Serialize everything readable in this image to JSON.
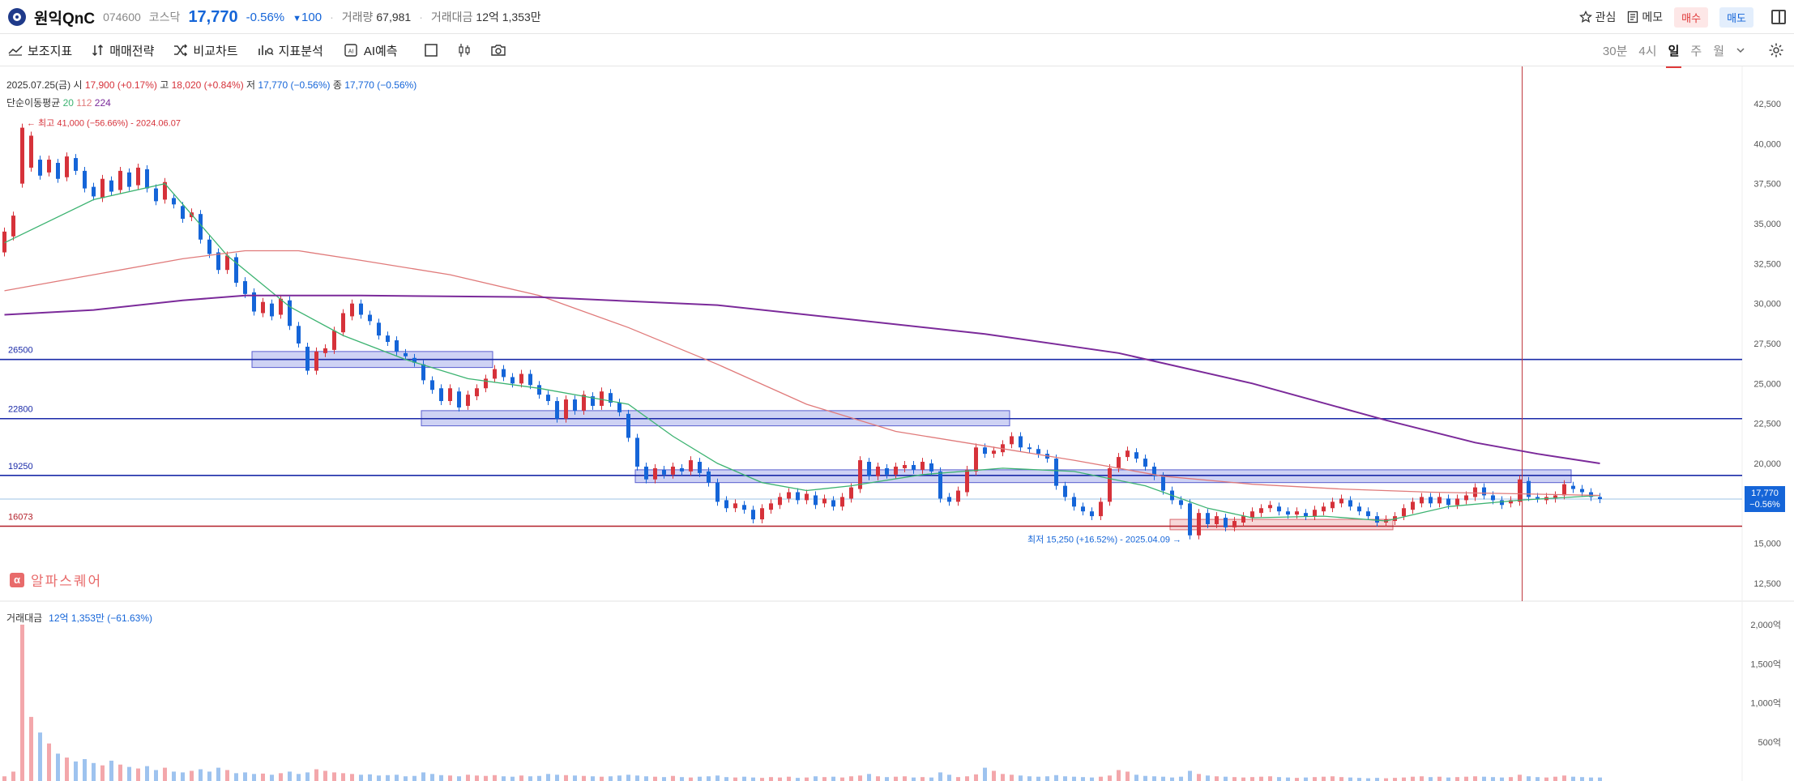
{
  "header": {
    "name": "원익QnC",
    "code": "074600",
    "market": "코스닥",
    "price": "17,770",
    "change_pct": "-0.56%",
    "change": "100",
    "volume_label": "거래량",
    "volume_value": "67,981",
    "amount_label": "거래대금",
    "amount_value": "12억 1,353만",
    "favorite_label": "관심",
    "memo_label": "메모",
    "buy_label": "매수",
    "sell_label": "매도"
  },
  "toolbar": {
    "indicators_label": "보조지표",
    "strategy_label": "매매전략",
    "compare_label": "비교차트",
    "analysis_label": "지표분석",
    "ai_label": "AI예측",
    "periods": [
      "30분",
      "4시",
      "일",
      "주",
      "월"
    ],
    "active_period": "일"
  },
  "info": {
    "date": "2025.07.25(금)",
    "open_label": "시",
    "open": "17,900 (+0.17%)",
    "high_label": "고",
    "high": "18,020 (+0.84%)",
    "low_label": "저",
    "low": "17,770 (−0.56%)",
    "close_label": "종",
    "close": "17,770 (−0.56%)",
    "ma_label": "단순이동평균",
    "ma1": "20",
    "ma2": "112",
    "ma3": "224"
  },
  "alpha": {
    "icon_letter": "α",
    "label": "알파스퀘어"
  },
  "volume_info": {
    "label": "거래대금",
    "value": "12억 1,353만 (−61.63%)"
  },
  "price_badge": {
    "price": "17,770",
    "pct": "−0.56%"
  },
  "colors": {
    "up": "#d6323a",
    "down": "#1565d8",
    "ma20": "#3cb371",
    "ma112": "#e07a7a",
    "ma224": "#7b2a9a",
    "level_blue": "#1a2aa8",
    "level_red": "#b3202a",
    "box_fill": "#b9bff0",
    "box_stroke": "#5a5fd0"
  },
  "chart_data": {
    "type": "candlestick",
    "y_ticks": [
      "42,500",
      "40,000",
      "37,500",
      "35,000",
      "32,500",
      "30,000",
      "27,500",
      "25,000",
      "22,500",
      "20,000",
      "17,500",
      "15,000",
      "12,500"
    ],
    "ylim": [
      12000,
      43500
    ],
    "x_range": [
      0,
      200
    ],
    "current_price": 17770,
    "max_label": "최고 41,000 (−56.66%) - 2024.06.07",
    "max": {
      "x": 2,
      "price": 41000
    },
    "min_label": "최저 15,250 (+16.52%) - 2025.04.09",
    "min": {
      "x": 133,
      "price": 15250
    },
    "levels": [
      {
        "label": "26500",
        "price": 26500,
        "color": "#1a2aa8"
      },
      {
        "label": "22800",
        "price": 22800,
        "color": "#1a2aa8"
      },
      {
        "label": "19250",
        "price": 19250,
        "color": "#1a2aa8"
      },
      {
        "label": "16073",
        "price": 16073,
        "color": "#b3202a"
      }
    ],
    "boxes": [
      {
        "x0": 28,
        "x1": 55,
        "top": 27000,
        "bottom": 26000,
        "color": "blue"
      },
      {
        "x0": 47,
        "x1": 113,
        "top": 23300,
        "bottom": 22350,
        "color": "blue"
      },
      {
        "x0": 71,
        "x1": 176,
        "top": 19600,
        "bottom": 18800,
        "color": "blue"
      },
      {
        "x0": 131,
        "x1": 156,
        "top": 16500,
        "bottom": 15850,
        "color": "red"
      }
    ],
    "crosshair_x": 170.5,
    "ma_series": [
      {
        "name": "20",
        "points": [
          [
            0,
            33800
          ],
          [
            10,
            36500
          ],
          [
            18,
            37500
          ],
          [
            25,
            33000
          ],
          [
            32,
            29800
          ],
          [
            38,
            28000
          ],
          [
            45,
            26500
          ],
          [
            52,
            25300
          ],
          [
            60,
            24700
          ],
          [
            70,
            23700
          ],
          [
            75,
            21700
          ],
          [
            80,
            20000
          ],
          [
            85,
            18800
          ],
          [
            90,
            18300
          ],
          [
            95,
            18600
          ],
          [
            103,
            19300
          ],
          [
            112,
            19700
          ],
          [
            120,
            19500
          ],
          [
            128,
            18600
          ],
          [
            135,
            17200
          ],
          [
            140,
            16600
          ],
          [
            148,
            16700
          ],
          [
            155,
            16400
          ],
          [
            162,
            17300
          ],
          [
            170,
            17700
          ],
          [
            179,
            18000
          ]
        ]
      },
      {
        "name": "112",
        "points": [
          [
            0,
            30800
          ],
          [
            10,
            31800
          ],
          [
            20,
            32800
          ],
          [
            27,
            33300
          ],
          [
            33,
            33300
          ],
          [
            40,
            32700
          ],
          [
            50,
            31800
          ],
          [
            60,
            30500
          ],
          [
            70,
            28500
          ],
          [
            80,
            26200
          ],
          [
            90,
            23700
          ],
          [
            100,
            22000
          ],
          [
            110,
            21100
          ],
          [
            120,
            20200
          ],
          [
            130,
            19200
          ],
          [
            140,
            18700
          ],
          [
            150,
            18400
          ],
          [
            160,
            18200
          ],
          [
            170,
            18100
          ],
          [
            179,
            18000
          ]
        ]
      },
      {
        "name": "224",
        "points": [
          [
            0,
            29300
          ],
          [
            10,
            29600
          ],
          [
            20,
            30200
          ],
          [
            27,
            30500
          ],
          [
            40,
            30500
          ],
          [
            60,
            30400
          ],
          [
            80,
            29900
          ],
          [
            95,
            29000
          ],
          [
            110,
            28100
          ],
          [
            125,
            26900
          ],
          [
            140,
            25000
          ],
          [
            155,
            22700
          ],
          [
            165,
            21300
          ],
          [
            172,
            20600
          ],
          [
            179,
            20000
          ]
        ]
      }
    ],
    "candles": [
      [
        0,
        33200,
        34500
      ],
      [
        1,
        34200,
        35500
      ],
      [
        2,
        37500,
        41000
      ],
      [
        3,
        38500,
        40500
      ],
      [
        4,
        39000,
        38000
      ],
      [
        5,
        38200,
        39000
      ],
      [
        6,
        38800,
        37800
      ],
      [
        7,
        37900,
        39200
      ],
      [
        8,
        39100,
        38300
      ],
      [
        9,
        38300,
        37200
      ],
      [
        10,
        37300,
        36700
      ],
      [
        11,
        36600,
        37800
      ],
      [
        12,
        37700,
        37000
      ],
      [
        13,
        37100,
        38300
      ],
      [
        14,
        38200,
        37300
      ],
      [
        15,
        37400,
        38500
      ],
      [
        16,
        38400,
        37200
      ],
      [
        17,
        37200,
        36400
      ],
      [
        18,
        36500,
        37600
      ],
      [
        19,
        36600,
        36200
      ],
      [
        20,
        36100,
        35300
      ],
      [
        21,
        35400,
        35700
      ],
      [
        22,
        35600,
        34000
      ],
      [
        23,
        34000,
        33100
      ],
      [
        24,
        33200,
        32100
      ],
      [
        25,
        32100,
        33000
      ],
      [
        26,
        32900,
        31300
      ],
      [
        27,
        31400,
        30600
      ],
      [
        28,
        30700,
        29500
      ],
      [
        29,
        29400,
        30100
      ],
      [
        30,
        30000,
        29200
      ],
      [
        31,
        29300,
        30300
      ],
      [
        32,
        30200,
        28600
      ],
      [
        33,
        28600,
        27500
      ],
      [
        34,
        27300,
        25800
      ],
      [
        35,
        25800,
        27000
      ],
      [
        36,
        26900,
        27200
      ],
      [
        37,
        27100,
        28300
      ],
      [
        38,
        28200,
        29400
      ],
      [
        39,
        29200,
        30000
      ],
      [
        40,
        30000,
        29300
      ],
      [
        41,
        29300,
        28900
      ],
      [
        42,
        28800,
        28000
      ],
      [
        43,
        28000,
        27600
      ],
      [
        44,
        27700,
        27000
      ],
      [
        45,
        26900,
        26700
      ],
      [
        46,
        26600,
        26300
      ],
      [
        47,
        26200,
        25200
      ],
      [
        48,
        25200,
        24600
      ],
      [
        49,
        24700,
        23900
      ],
      [
        50,
        23900,
        24700
      ],
      [
        51,
        24500,
        23500
      ],
      [
        52,
        23600,
        24300
      ],
      [
        53,
        24200,
        24700
      ],
      [
        54,
        24700,
        25300
      ],
      [
        55,
        25300,
        25900
      ],
      [
        56,
        25900,
        25400
      ],
      [
        57,
        25400,
        25000
      ],
      [
        58,
        25000,
        25600
      ],
      [
        59,
        25600,
        24900
      ],
      [
        60,
        24900,
        24300
      ],
      [
        61,
        24300,
        23900
      ],
      [
        62,
        23900,
        22800
      ],
      [
        63,
        22800,
        24000
      ],
      [
        64,
        24000,
        23300
      ],
      [
        65,
        23300,
        24300
      ],
      [
        66,
        24200,
        23600
      ],
      [
        67,
        23600,
        24500
      ],
      [
        68,
        24400,
        23800
      ],
      [
        69,
        23800,
        23200
      ],
      [
        70,
        23100,
        21600
      ],
      [
        71,
        21600,
        19800
      ],
      [
        72,
        19800,
        19000
      ],
      [
        73,
        19000,
        19700
      ],
      [
        74,
        19600,
        19300
      ],
      [
        75,
        19300,
        19800
      ],
      [
        76,
        19700,
        19500
      ],
      [
        77,
        19500,
        20200
      ],
      [
        78,
        20100,
        19400
      ],
      [
        79,
        19500,
        18800
      ],
      [
        80,
        18800,
        17600
      ],
      [
        81,
        17700,
        17200
      ],
      [
        82,
        17200,
        17500
      ],
      [
        83,
        17400,
        17100
      ],
      [
        84,
        17100,
        16500
      ],
      [
        85,
        16500,
        17200
      ],
      [
        86,
        17100,
        17500
      ],
      [
        87,
        17400,
        17900
      ],
      [
        88,
        17800,
        18200
      ],
      [
        89,
        18200,
        17700
      ],
      [
        90,
        17700,
        18100
      ],
      [
        91,
        18000,
        17400
      ],
      [
        92,
        17500,
        17800
      ],
      [
        93,
        17700,
        17300
      ],
      [
        94,
        17300,
        17900
      ],
      [
        95,
        17800,
        18500
      ],
      [
        96,
        18400,
        20200
      ],
      [
        97,
        20100,
        19200
      ],
      [
        98,
        19200,
        19800
      ],
      [
        99,
        19700,
        19300
      ],
      [
        100,
        19300,
        19800
      ],
      [
        101,
        19700,
        19900
      ],
      [
        102,
        19900,
        19600
      ],
      [
        103,
        19600,
        20100
      ],
      [
        104,
        20000,
        19500
      ],
      [
        105,
        19500,
        17800
      ],
      [
        106,
        17900,
        17600
      ],
      [
        107,
        17600,
        18300
      ],
      [
        108,
        18200,
        19600
      ],
      [
        109,
        19500,
        21000
      ],
      [
        110,
        21000,
        20600
      ],
      [
        111,
        20600,
        20800
      ],
      [
        112,
        20700,
        21200
      ],
      [
        113,
        21200,
        21700
      ],
      [
        114,
        21700,
        21000
      ],
      [
        115,
        21000,
        20900
      ],
      [
        116,
        20900,
        20600
      ],
      [
        117,
        20600,
        20300
      ],
      [
        118,
        20300,
        18600
      ],
      [
        119,
        18600,
        17900
      ],
      [
        120,
        17900,
        17300
      ],
      [
        121,
        17300,
        17000
      ],
      [
        122,
        17000,
        16700
      ],
      [
        123,
        16700,
        17600
      ],
      [
        124,
        17600,
        19700
      ],
      [
        125,
        19700,
        20400
      ],
      [
        126,
        20400,
        20800
      ],
      [
        127,
        20700,
        20300
      ],
      [
        128,
        20300,
        19800
      ],
      [
        129,
        19800,
        19200
      ],
      [
        130,
        19200,
        18300
      ],
      [
        131,
        18300,
        17700
      ],
      [
        132,
        17700,
        17400
      ],
      [
        133,
        17500,
        15500
      ],
      [
        134,
        15500,
        16900
      ],
      [
        135,
        16900,
        16200
      ],
      [
        136,
        16200,
        16700
      ],
      [
        137,
        16600,
        16000
      ],
      [
        138,
        16000,
        16400
      ],
      [
        139,
        16300,
        16700
      ],
      [
        140,
        16600,
        17000
      ],
      [
        141,
        16900,
        17200
      ],
      [
        142,
        17200,
        17400
      ],
      [
        143,
        17300,
        17000
      ],
      [
        144,
        17000,
        16800
      ],
      [
        145,
        16800,
        17000
      ],
      [
        146,
        16900,
        16700
      ],
      [
        147,
        16700,
        17100
      ],
      [
        148,
        17000,
        17300
      ],
      [
        149,
        17200,
        17600
      ],
      [
        150,
        17500,
        17800
      ],
      [
        151,
        17700,
        17300
      ],
      [
        152,
        17300,
        17000
      ],
      [
        153,
        17000,
        16700
      ],
      [
        154,
        16700,
        16300
      ],
      [
        155,
        16300,
        16500
      ],
      [
        156,
        16400,
        16700
      ],
      [
        157,
        16700,
        17200
      ],
      [
        158,
        17100,
        17600
      ],
      [
        159,
        17500,
        17900
      ],
      [
        160,
        17900,
        17500
      ],
      [
        161,
        17500,
        17900
      ],
      [
        162,
        17800,
        17400
      ],
      [
        163,
        17400,
        17800
      ],
      [
        164,
        17700,
        18000
      ],
      [
        165,
        17900,
        18500
      ],
      [
        166,
        18500,
        18000
      ],
      [
        167,
        18000,
        17700
      ],
      [
        168,
        17700,
        17400
      ],
      [
        169,
        17500,
        17700
      ],
      [
        170,
        17600,
        19000
      ],
      [
        171,
        18900,
        17900
      ],
      [
        172,
        17900,
        17800
      ],
      [
        173,
        17700,
        17900
      ],
      [
        174,
        17800,
        18000
      ],
      [
        175,
        18000,
        18700
      ],
      [
        176,
        18600,
        18400
      ],
      [
        177,
        18400,
        18200
      ],
      [
        178,
        18200,
        17900
      ],
      [
        179,
        17900,
        17770
      ]
    ],
    "volume_ticks": [
      "2,000억",
      "1,500억",
      "1,000억",
      "500억"
    ],
    "volume_ylim": [
      0,
      2200
    ],
    "volume": [
      60,
      120,
      2000,
      820,
      620,
      480,
      350,
      300,
      250,
      280,
      230,
      200,
      260,
      210,
      180,
      160,
      190,
      140,
      170,
      120,
      110,
      130,
      150,
      120,
      170,
      140,
      100,
      110,
      90,
      95,
      80,
      100,
      120,
      90,
      110,
      150,
      130,
      110,
      100,
      90,
      80,
      85,
      70,
      75,
      80,
      60,
      65,
      110,
      90,
      75,
      70,
      60,
      80,
      70,
      65,
      75,
      60,
      55,
      70,
      60,
      65,
      90,
      80,
      75,
      70,
      65,
      60,
      55,
      60,
      70,
      80,
      70,
      60,
      55,
      50,
      65,
      50,
      45,
      55,
      60,
      70,
      50,
      45,
      55,
      45,
      40,
      50,
      45,
      55,
      40,
      45,
      60,
      50,
      55,
      45,
      60,
      70,
      90,
      60,
      50,
      55,
      60,
      45,
      50,
      45,
      110,
      80,
      50,
      60,
      85,
      170,
      130,
      90,
      80,
      70,
      60,
      55,
      60,
      75,
      60,
      55,
      50,
      45,
      55,
      70,
      140,
      120,
      80,
      65,
      60,
      55,
      45,
      55,
      130,
      90,
      70,
      60,
      55,
      50,
      45,
      50,
      55,
      60,
      50,
      45,
      40,
      45,
      50,
      55,
      60,
      50,
      45,
      40,
      35,
      40,
      35,
      40,
      45,
      55,
      60,
      50,
      55,
      45,
      50,
      55,
      60,
      55,
      50,
      45,
      50,
      80,
      60,
      50,
      45,
      55,
      70,
      55,
      50,
      45,
      45
    ]
  }
}
